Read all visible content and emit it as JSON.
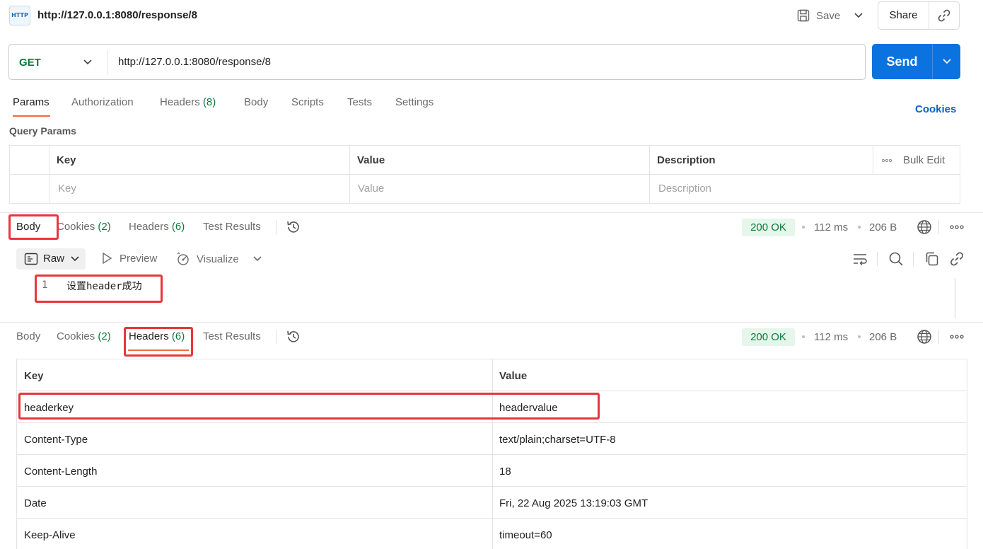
{
  "header": {
    "icon_text": "HTTP",
    "title": "http://127.0.0.1:8080/response/8",
    "save_label": "Save",
    "share_label": "Share"
  },
  "request": {
    "method": "GET",
    "url": "http://127.0.0.1:8080/response/8",
    "send_label": "Send"
  },
  "request_tabs": {
    "params": "Params",
    "authorization": "Authorization",
    "headers": "Headers",
    "headers_count": "(8)",
    "body": "Body",
    "scripts": "Scripts",
    "tests": "Tests",
    "settings": "Settings",
    "cookies": "Cookies"
  },
  "query_params": {
    "title": "Query Params",
    "columns": {
      "key": "Key",
      "value": "Value",
      "description": "Description"
    },
    "bulk_edit": "Bulk Edit",
    "placeholders": {
      "key": "Key",
      "value": "Value",
      "description": "Description"
    }
  },
  "response_tabs": {
    "body": "Body",
    "cookies": "Cookies",
    "cookies_count": "(2)",
    "headers": "Headers",
    "headers_count": "(6)",
    "test_results": "Test Results"
  },
  "response_meta": {
    "status": "200 OK",
    "time": "112 ms",
    "size": "206 B"
  },
  "body_toolbar": {
    "raw": "Raw",
    "preview": "Preview",
    "visualize": "Visualize"
  },
  "body_editor": {
    "line_number": "1",
    "content": "设置header成功"
  },
  "response_headers": {
    "columns": {
      "key": "Key",
      "value": "Value"
    },
    "rows": [
      {
        "key": "headerkey",
        "value": "headervalue"
      },
      {
        "key": "Content-Type",
        "value": "text/plain;charset=UTF-8"
      },
      {
        "key": "Content-Length",
        "value": "18"
      },
      {
        "key": "Date",
        "value": "Fri, 22 Aug 2025 13:19:03 GMT"
      },
      {
        "key": "Keep-Alive",
        "value": "timeout=60"
      }
    ]
  },
  "colors": {
    "accent": "#0b73e0",
    "method_green": "#0a7a3c",
    "tab_underline": "#f26b3a",
    "annotation_red": "#e8363a",
    "status_bg": "#e5f6ea"
  },
  "icons": [
    "http-icon",
    "save-icon",
    "chevron-down-icon",
    "link-icon",
    "history-icon",
    "globe-icon",
    "more-icon",
    "raw-icon",
    "play-icon",
    "visualize-icon",
    "wrap-icon",
    "search-icon",
    "copy-icon"
  ]
}
